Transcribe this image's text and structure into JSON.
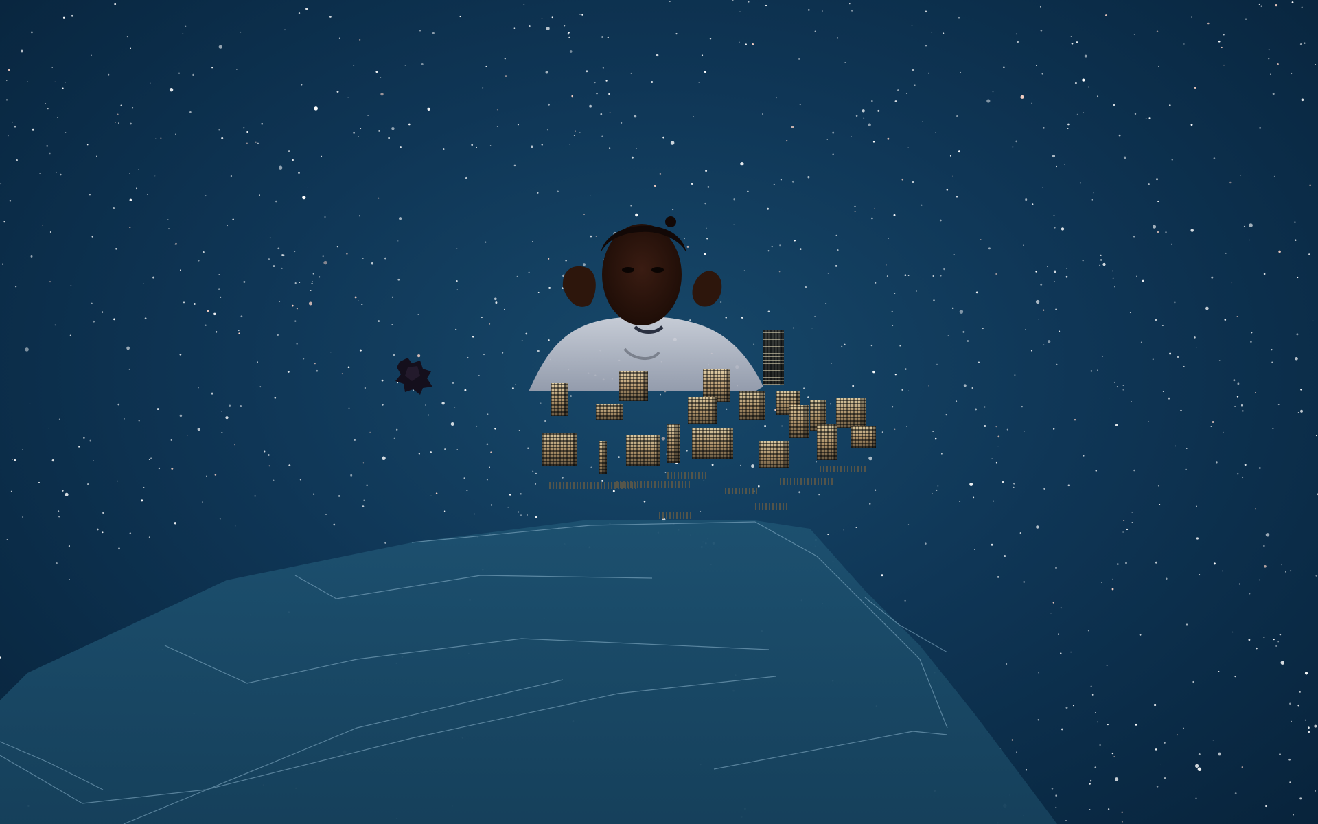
{
  "scene": {
    "type": "3d-space-environment",
    "sky_color": "#0f3656",
    "star_color": "#ffffff",
    "terrain_color": "#1b4a66",
    "terrain_line_color": "#8fb7cf",
    "building_light_color": "#e9d3a6"
  },
  "objects": {
    "avatar_icon": "person-video-avatar",
    "drone_icon": "floating-debris",
    "city_icon": "miniature-city-blocks",
    "planet_icon": "planet-surface"
  }
}
